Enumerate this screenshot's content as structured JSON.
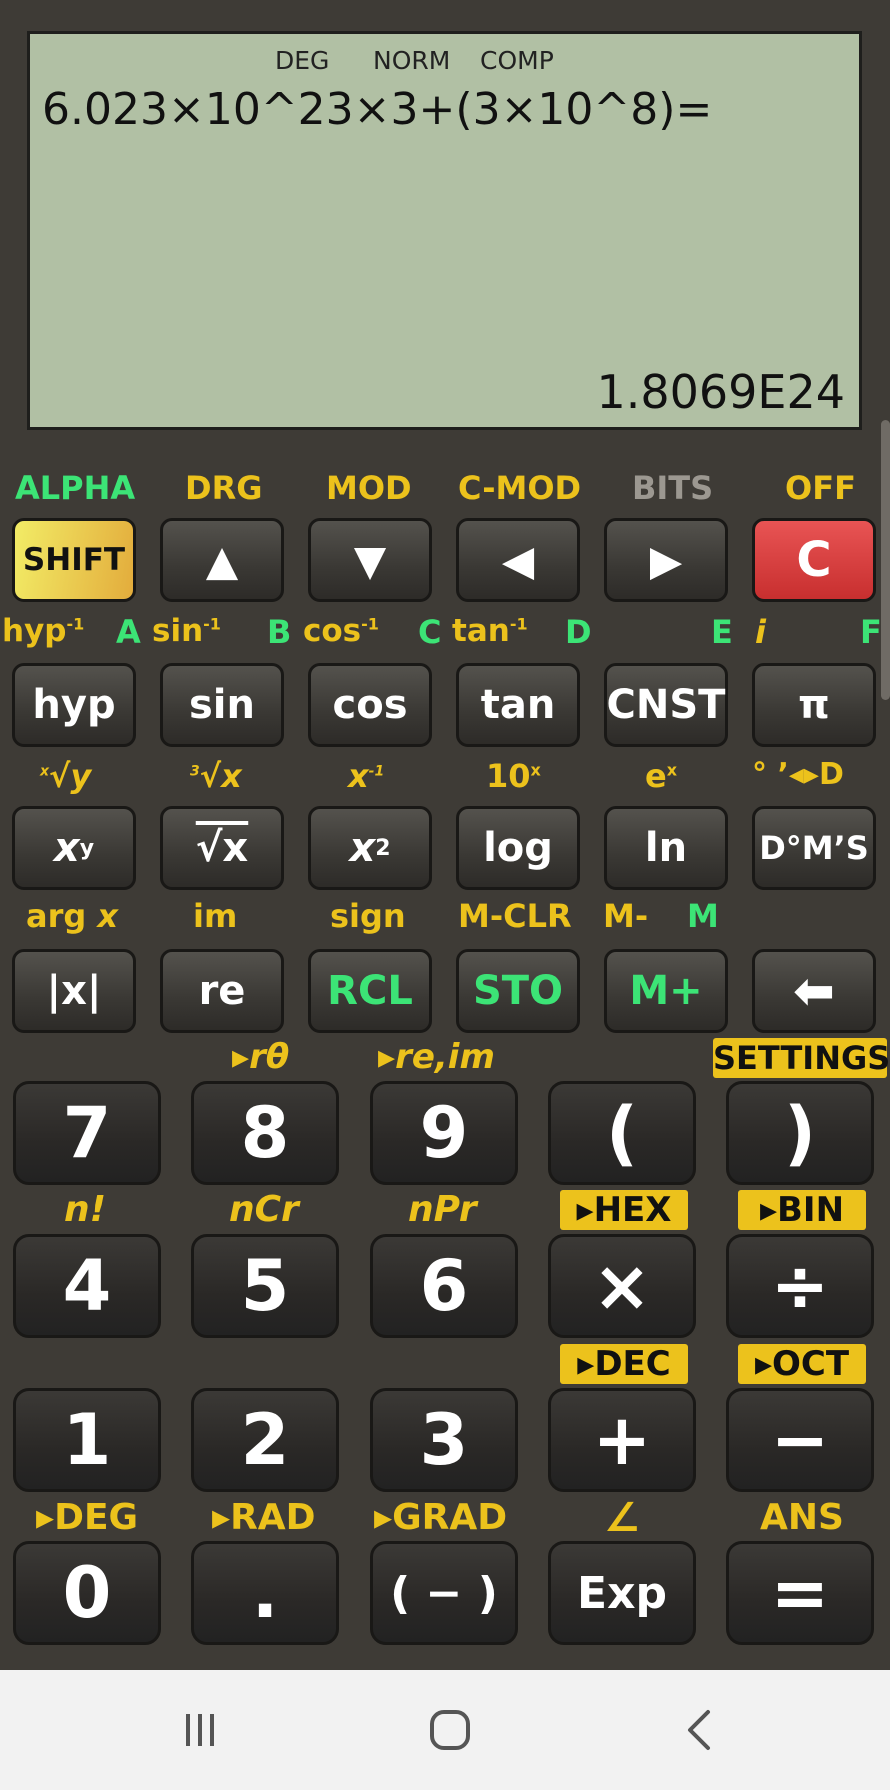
{
  "display": {
    "indicators": [
      "DEG",
      "NORM",
      "COMP"
    ],
    "expression": "6.023×10^23×3+(3×10^8)=",
    "result": "1.8069E24"
  },
  "row1_labels": [
    "ALPHA",
    "DRG",
    "MOD",
    "C-MOD",
    "BITS",
    "OFF"
  ],
  "row1_keys": {
    "shift": "SHIFT",
    "up": "▲",
    "down": "▼",
    "left": "◀",
    "right": "▶",
    "clear": "C"
  },
  "row2_labels": {
    "hyp_inv": "hyp",
    "sup": "-1",
    "a": "A",
    "asin": "sin",
    "b": "B",
    "acos": "cos",
    "c": "C",
    "atan": "tan",
    "d": "D",
    "e": "E",
    "i": "i",
    "f": "F"
  },
  "row2_keys": [
    "hyp",
    "sin",
    "cos",
    "tan",
    "CNST",
    "π"
  ],
  "row3_labels": {
    "xrooty": "√y",
    "xrooty_pre": "x",
    "cbrt": "√x",
    "cbrt_pre": "3",
    "xinv": "x",
    "xinv_sup": "-1",
    "ten": "10",
    "ten_sup": "x",
    "e": "e",
    "e_sup": "x",
    "dms": "° ’◂▸D"
  },
  "row3_keys": {
    "xy": "x",
    "xy_sup": "y",
    "sqrt": "√x",
    "x2": "x",
    "x2_sup": "2",
    "log": "log",
    "ln": "ln",
    "dms": "D°M’S"
  },
  "row4_labels": {
    "arg": "arg",
    "arg_x": "x",
    "im": "im",
    "sign": "sign",
    "mclr": "M-CLR",
    "mminus": "M-",
    "m": "M"
  },
  "row4_keys": {
    "abs": "|x|",
    "re": "re",
    "rcl": "RCL",
    "sto": "STO",
    "mplus": "M+",
    "back": "⬅"
  },
  "num_labels": {
    "rtheta": "▸rθ",
    "reim": "▸re,im",
    "settings": "SETTINGS",
    "fact": "n!",
    "ncr": "nCr",
    "npr": "nPr",
    "hex": "▸HEX",
    "bin": "▸BIN",
    "dec": "▸DEC",
    "oct": "▸OCT",
    "deg": "▸DEG",
    "rad": "▸RAD",
    "grad": "▸GRAD",
    "angle": "∠",
    "ans": "ANS"
  },
  "num_keys": {
    "k7": "7",
    "k8": "8",
    "k9": "9",
    "lpar": "(",
    "rpar": ")",
    "k4": "4",
    "k5": "5",
    "k6": "6",
    "mul": "×",
    "div": "÷",
    "k1": "1",
    "k2": "2",
    "k3": "3",
    "plus": "+",
    "minus": "−",
    "k0": "0",
    "dot": ".",
    "neg": "( − )",
    "exp": "Exp",
    "eq": "="
  },
  "colors": {
    "shift_label": "#3ce476",
    "secondary": "#ecc21c",
    "lcd": "#b1c0a4",
    "clear": "#d84040"
  },
  "navbar": {
    "recent_icon": "recent-apps-icon",
    "home_icon": "home-icon",
    "back_icon": "back-icon"
  }
}
